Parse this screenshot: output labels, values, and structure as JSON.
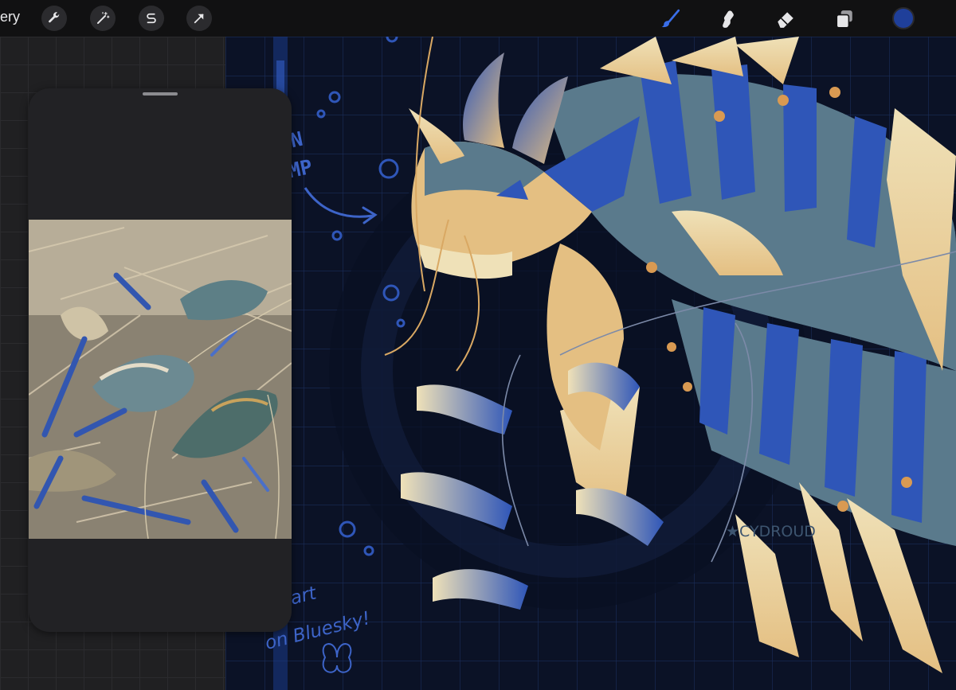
{
  "toolbar": {
    "gallery_label": "ery",
    "left_tools": [
      "wrench-icon",
      "magic-wand-icon",
      "selection-icon",
      "transform-arrow-icon"
    ],
    "right_tools": [
      "brush-icon",
      "smudge-icon",
      "eraser-icon",
      "layers-icon"
    ],
    "current_color": "#1f3f9a",
    "active_tool_color": "#3a6ee8"
  },
  "reference": {
    "image_subject": "shrimp-photo"
  },
  "artwork": {
    "title_line1": "DRAGON",
    "title_line2": "SHRIMP",
    "note_line1": "Full art",
    "note_line2": "on Bluesky!",
    "signature": "★CYDROUD",
    "palette": {
      "background": "#0b1226",
      "grid": "#1a2d5a",
      "blue": "#2f56b8",
      "gold": "#e4bf82",
      "cream": "#efe1b8",
      "teal": "#5a7a8c",
      "text_blue": "#3d64c8"
    }
  }
}
